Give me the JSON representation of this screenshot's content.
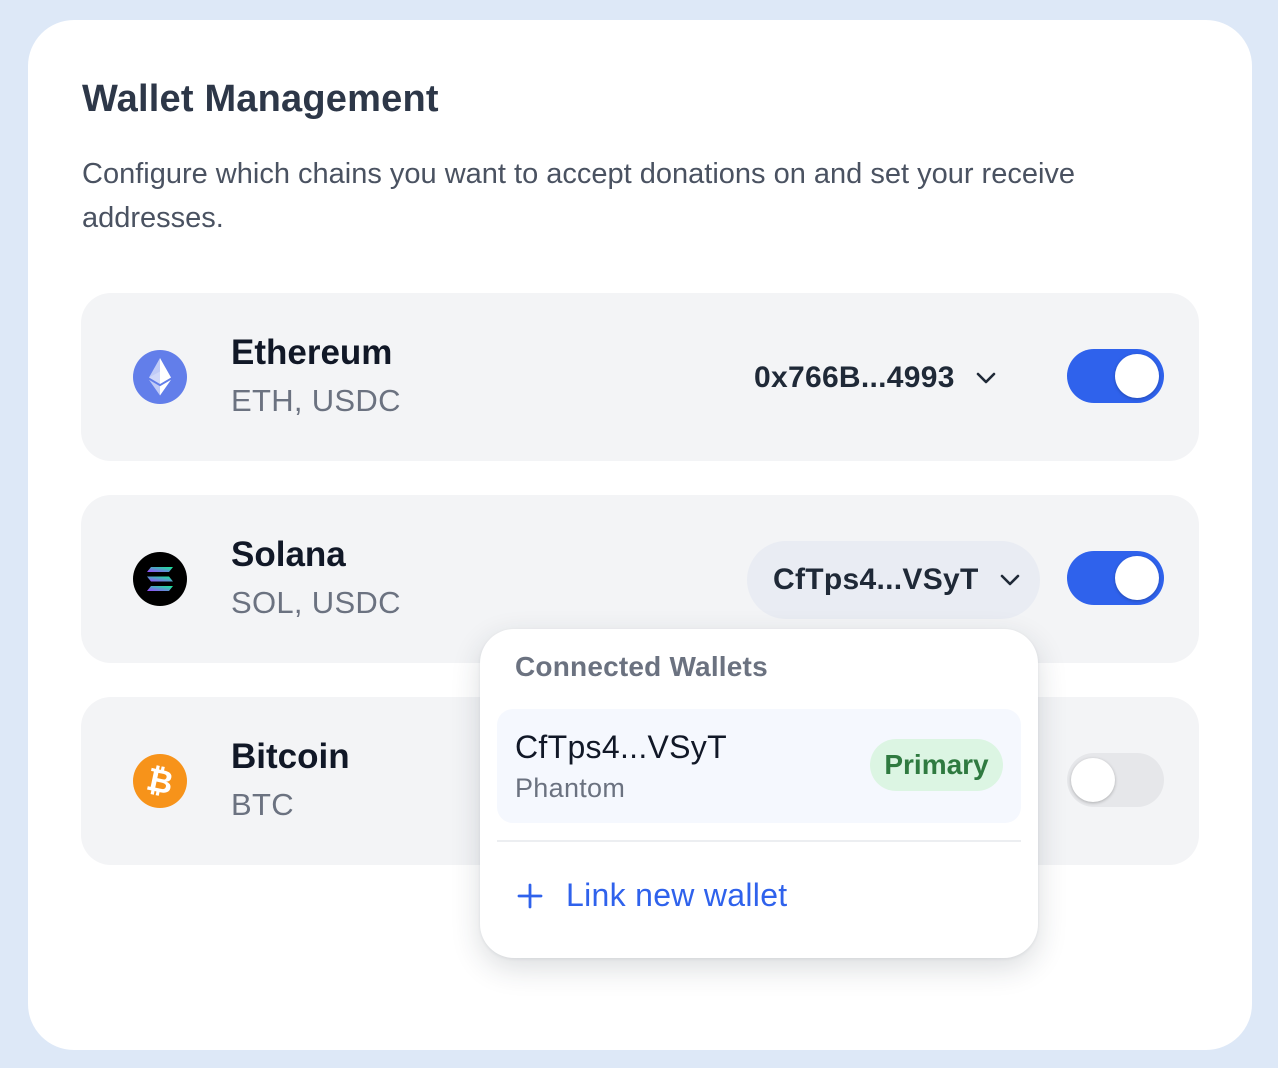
{
  "page": {
    "title": "Wallet Management",
    "description": "Configure which chains you want to accept donations on and set your receive addresses."
  },
  "chains": [
    {
      "name": "Ethereum",
      "assets": "ETH, USDC",
      "icon": "ethereum-icon",
      "address": "0x766B...4993",
      "enabled": true,
      "accent": "#627eea"
    },
    {
      "name": "Solana",
      "assets": "SOL, USDC",
      "icon": "solana-icon",
      "address": "CfTps4...VSyT",
      "enabled": true,
      "accent": "#000000"
    },
    {
      "name": "Bitcoin",
      "assets": "BTC",
      "icon": "bitcoin-icon",
      "enabled": false,
      "accent": "#f7931a"
    }
  ],
  "dropdown": {
    "heading": "Connected Wallets",
    "wallets": [
      {
        "address": "CfTps4...VSyT",
        "provider": "Phantom",
        "badge": "Primary"
      }
    ],
    "link_label": "Link new wallet",
    "link_icon": "plus-icon"
  },
  "colors": {
    "toggle_on": "#2f62ec",
    "toggle_off": "#e6e7ea",
    "badge_bg": "#dcf5e3",
    "badge_text": "#2f7a40",
    "link": "#2f62ec"
  }
}
